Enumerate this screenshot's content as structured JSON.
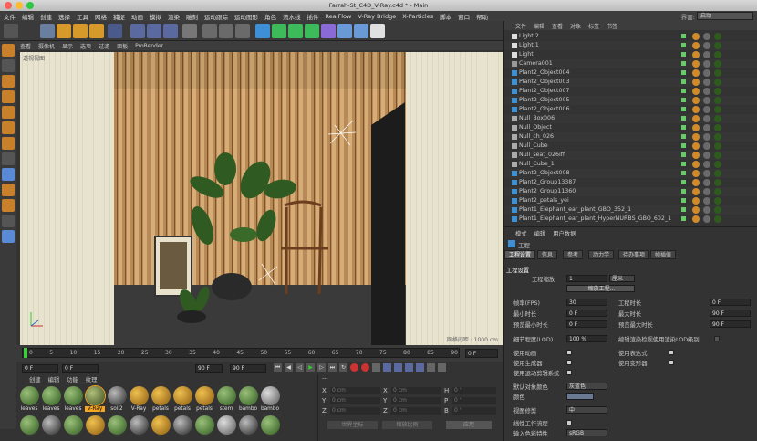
{
  "window": {
    "title": "Farrah-St_C4D_V-Ray.c4d * - Main"
  },
  "menu": [
    "文件",
    "编辑",
    "创建",
    "选择",
    "工具",
    "网格",
    "捕捉",
    "动画",
    "模拟",
    "渲染",
    "雕刻",
    "运动跟踪",
    "运动图形",
    "角色",
    "流水线",
    "插件",
    "RealFlow",
    "V-Ray Bridge",
    "X-Particles",
    "脚本",
    "窗口",
    "帮助"
  ],
  "layout": {
    "label": "界面:",
    "value": "启动"
  },
  "viewport": {
    "menu": [
      "查看",
      "摄像机",
      "显示",
      "选项",
      "过滤",
      "面板",
      "ProRender"
    ],
    "label": "透视视图",
    "grid_info": "网格间距 : 1000 cm"
  },
  "timeline": {
    "ticks": [
      "0",
      "5",
      "10",
      "15",
      "20",
      "25",
      "30",
      "35",
      "40",
      "45",
      "50",
      "55",
      "60",
      "65",
      "70",
      "75",
      "80",
      "85",
      "90"
    ],
    "end_label": "0 F"
  },
  "transport": {
    "f1": "0 F",
    "f2": "0 F",
    "f3": "90 F",
    "f4": "90 F"
  },
  "materials": {
    "menu": [
      "创建",
      "编辑",
      "功能",
      "纹理"
    ],
    "row1": [
      "leaves",
      "leaves",
      "leaves",
      "V-Ray",
      "soil2",
      "V-Ray",
      "petals",
      "petals",
      "petals",
      "stem",
      "bambo",
      "bambo"
    ],
    "row2": [
      "",
      "",
      "",
      "",
      "",
      "",
      "",
      "",
      "",
      "",
      "",
      ""
    ]
  },
  "coords": {
    "header": "---",
    "rows": [
      [
        "X",
        "0 cm",
        "X",
        "0 cm",
        "H",
        "0 °"
      ],
      [
        "Y",
        "0 cm",
        "Y",
        "0 cm",
        "P",
        "0 °"
      ],
      [
        "Z",
        "0 cm",
        "Z",
        "0 cm",
        "B",
        "0 °"
      ]
    ],
    "mode1": "世界坐标",
    "mode2": "缩放比例",
    "apply": "应用"
  },
  "objects": {
    "menu": [
      "文件",
      "编辑",
      "查看",
      "对象",
      "标签",
      "书签"
    ],
    "items": [
      "Light.2",
      "Light.1",
      "Light",
      "Camera001",
      "Plant2_Object004",
      "Plant2_Object003",
      "Plant2_Object007",
      "Plant2_Object005",
      "Plant2_Object006",
      "Null_Box006",
      "Null_Object",
      "Null_ch_026",
      "Null_Cube",
      "Null_seat_026iff",
      "Null_Cube_1",
      "Plant2_Object008",
      "Plant2_Group13387",
      "Plant2_Group11360",
      "Plant2_petals_yei",
      "Plant1_Elephant_ear_plant_GBO_352_1",
      "Plant1_Elephant_ear_plant_HyperNURBS_GBO_602_1"
    ]
  },
  "attributes": {
    "menu": [
      "模式",
      "编辑",
      "用户数据"
    ],
    "title": "工程",
    "tabs": [
      "工程设置",
      "信息",
      "参考",
      "动力学",
      "待办事项",
      "帧插值"
    ],
    "section": "工程设置",
    "scale_label": "工程缩放",
    "scale_value": "1",
    "scale_unit": "厘米",
    "scale_btn": "缩放工程...",
    "fps_label": "帧率(FPS)",
    "fps": "30",
    "proj_len_label": "工程时长",
    "proj_len": "0 F",
    "min_label": "最小时长",
    "min": "0 F",
    "max_label": "最大时长",
    "max": "90 F",
    "pmin_label": "预览最小时长",
    "pmin": "0 F",
    "pmax_label": "预览最大时长",
    "pmax": "90 F",
    "lod_label": "细节程度(LOD)",
    "lod": "100 %",
    "lod_render": "编辑渲染检视使用渲染LOD级别",
    "anim_label": "使用动画",
    "expr_label": "使用表达式",
    "gen_label": "使用生成器",
    "deform_label": "使用变形器",
    "motion_label": "使用运动剪辑系统",
    "defcolor_label": "默认对象颜色",
    "defcolor": "灰蓝色",
    "color_label": "颜色",
    "clip_label": "视图修剪",
    "clip": "中",
    "linear_label": "线性工作流程",
    "input_label": "输入色彩特性",
    "input": "sRGB"
  }
}
